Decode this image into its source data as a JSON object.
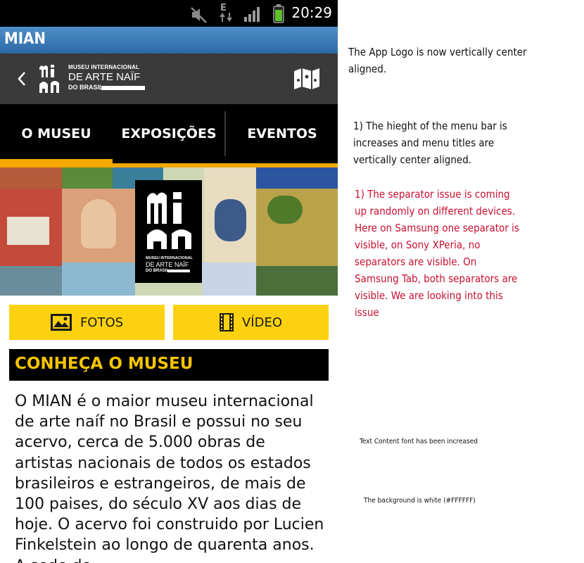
{
  "status_bar": {
    "time": "20:29",
    "network": "E",
    "icons": [
      "mute-icon",
      "data-arrows-icon",
      "signal-icon",
      "battery-icon"
    ]
  },
  "title_bar": {
    "title": "MIAN"
  },
  "header": {
    "back_icon": "chevron-left-icon",
    "logo": {
      "line1": "MUSEU INTERNACIONAL",
      "line2": "DE ARTE NAÏF",
      "line3": "DO BRASIL"
    },
    "map_icon": "map-icon"
  },
  "menu": {
    "items": [
      {
        "label": "O MUSEU",
        "active": true
      },
      {
        "label": "EXPOSIÇÕES",
        "active": false
      },
      {
        "label": "EVENTOS",
        "active": false
      }
    ],
    "accent_color": "#f5a800"
  },
  "banner_logo": {
    "line1": "MUSEU INTERNACIONAL",
    "line2": "DE ARTE NAÏF",
    "line3": "DO BRASIL"
  },
  "buttons": {
    "fotos": "FOTOS",
    "video": "VÍDEO",
    "color": "#fcd10f"
  },
  "section": {
    "title": "CONHEÇA O MUSEU",
    "title_color": "#f6c400"
  },
  "body_text": "O MIAN é o maior museu internacional de arte naíf no Brasil e possui no seu acervo, cerca de 5.000 obras de artistas nacionais de todos os estados brasileiros e estrangeiros, de mais de 100 paises, do século XV aos dias de hoje. O acervo foi construido por Lucien Finkelstein ao longo de quarenta anos. A sede do",
  "notes": {
    "logo_note": "The App Logo is now vertically center aligned.",
    "menu_note": "1) The hieght of the menu bar is increases and menu titles are vertically center aligned.",
    "separator_note": "1) The separator issue is coming up randomly on different devices. Here on Samsung one separator is visible, on Sony XPeria, no separators are visible. On Samsung Tab, both separators are visible. We are looking into this issue",
    "font_note": "Text Content font has been increased",
    "bg_note": "The background is white (#FFFFFF)",
    "red_color": "#c8102e"
  }
}
